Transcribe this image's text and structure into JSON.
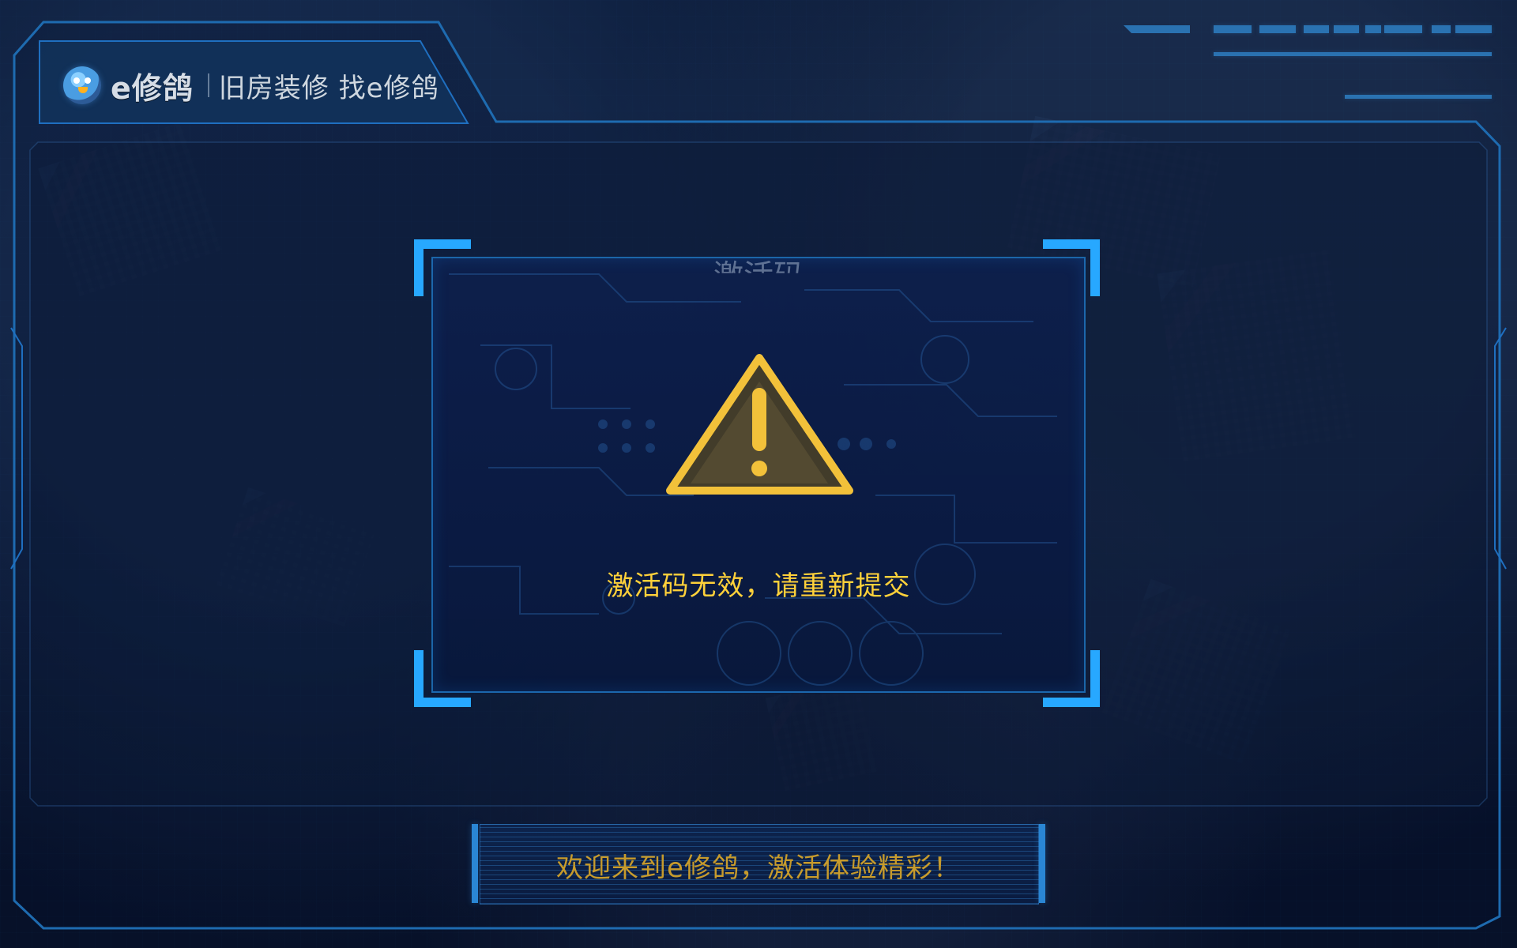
{
  "app": {
    "brand": "e修鸽",
    "slogan": "旧房装修 找e修鸽"
  },
  "dialog": {
    "title": "激活码",
    "message": "激活码无效，请重新提交",
    "icon": "warning-icon"
  },
  "banner": {
    "text": "欢迎来到e修鸽，激活体验精彩！"
  },
  "colors": {
    "accent": "#27A8FF",
    "warning": "#FFD13A",
    "banner_text": "#C79B2C",
    "background": "#071129"
  }
}
